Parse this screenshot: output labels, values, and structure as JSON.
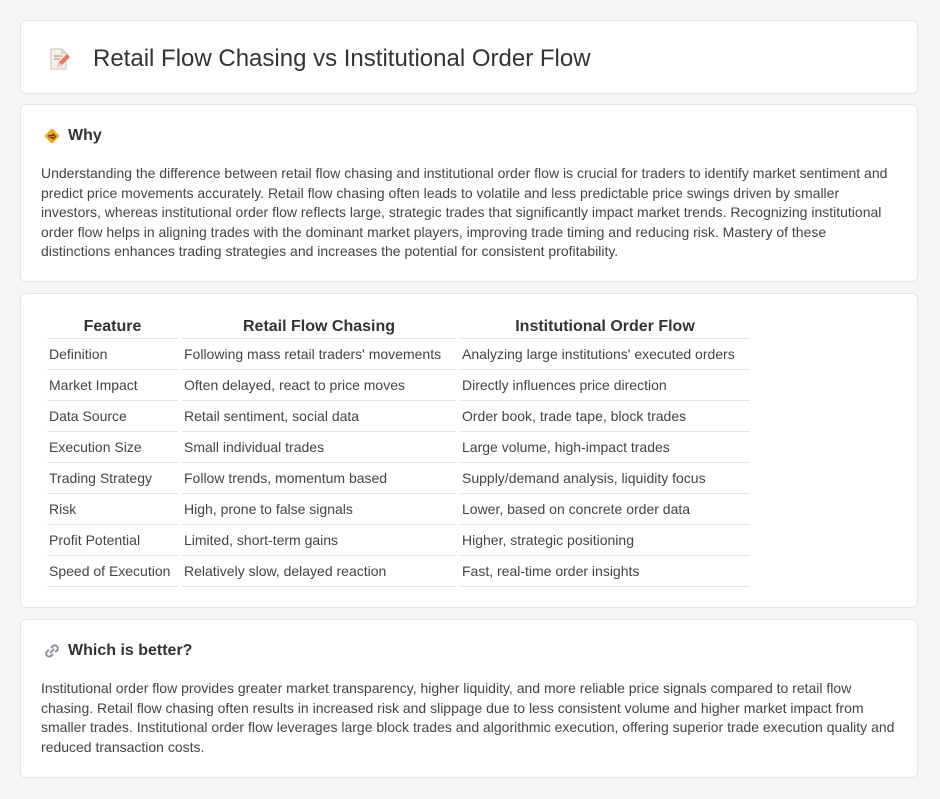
{
  "title": "Retail Flow Chasing vs Institutional Order Flow",
  "why": {
    "heading": "Why",
    "text": "Understanding the difference between retail flow chasing and institutional order flow is crucial for traders to identify market sentiment and predict price movements accurately. Retail flow chasing often leads to volatile and less predictable price swings driven by smaller investors, whereas institutional order flow reflects large, strategic trades that significantly impact market trends. Recognizing institutional order flow helps in aligning trades with the dominant market players, improving trade timing and reducing risk. Mastery of these distinctions enhances trading strategies and increases the potential for consistent profitability."
  },
  "table": {
    "headers": [
      "Feature",
      "Retail Flow Chasing",
      "Institutional Order Flow"
    ],
    "rows": [
      [
        "Definition",
        "Following mass retail traders' movements",
        "Analyzing large institutions' executed orders"
      ],
      [
        "Market Impact",
        "Often delayed, react to price moves",
        "Directly influences price direction"
      ],
      [
        "Data Source",
        "Retail sentiment, social data",
        "Order book, trade tape, block trades"
      ],
      [
        "Execution Size",
        "Small individual trades",
        "Large volume, high-impact trades"
      ],
      [
        "Trading Strategy",
        "Follow trends, momentum based",
        "Supply/demand analysis, liquidity focus"
      ],
      [
        "Risk",
        "High, prone to false signals",
        "Lower, based on concrete order data"
      ],
      [
        "Profit Potential",
        "Limited, short-term gains",
        "Higher, strategic positioning"
      ],
      [
        "Speed of Execution",
        "Relatively slow, delayed reaction",
        "Fast, real-time order insights"
      ]
    ]
  },
  "better": {
    "heading": "Which is better?",
    "text": "Institutional order flow provides greater market transparency, higher liquidity, and more reliable price signals compared to retail flow chasing. Retail flow chasing often results in increased risk and slippage due to less consistent volume and higher market impact from smaller trades. Institutional order flow leverages large block trades and algorithmic execution, offering superior trade execution quality and reduced transaction costs."
  },
  "icons": {
    "title": "memo-pencil-icon",
    "why": "diamond-direction-icon",
    "better": "link-icon"
  }
}
